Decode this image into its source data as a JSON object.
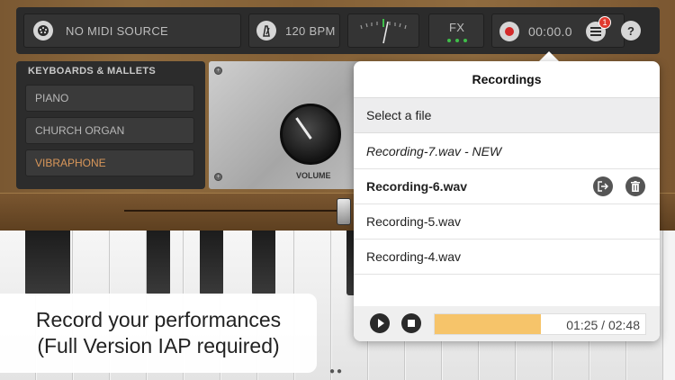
{
  "topbar": {
    "midi_source": "NO MIDI SOURCE",
    "tempo": "120 BPM",
    "fx_label": "FX",
    "timer": "00:00.0",
    "badge_count": "1",
    "help_label": "?"
  },
  "instruments": {
    "header": "KEYBOARDS & MALLETS",
    "items": [
      {
        "label": "PIANO"
      },
      {
        "label": "CHURCH ORGAN"
      },
      {
        "label": "VIBRAPHONE",
        "selected": true
      }
    ]
  },
  "panel": {
    "volume_label": "VOLUME"
  },
  "recordings": {
    "title": "Recordings",
    "subhead": "Select a file",
    "files": [
      {
        "name": "Recording-7.wav - NEW",
        "style": "italic"
      },
      {
        "name": "Recording-6.wav",
        "style": "bold",
        "selected": true
      },
      {
        "name": "Recording-5.wav",
        "style": "normal"
      },
      {
        "name": "Recording-4.wav",
        "style": "normal"
      }
    ],
    "player": {
      "time": "01:25 / 02:48",
      "progress_fraction": 0.506
    }
  },
  "caption": {
    "line1": "Record your performances",
    "line2": "(Full Version IAP required)"
  },
  "colors": {
    "accent_orange": "#f6c46a",
    "vibraphone_orange": "#d9975a",
    "record_red": "#d42b2b",
    "fx_green": "#3fbf4a"
  }
}
